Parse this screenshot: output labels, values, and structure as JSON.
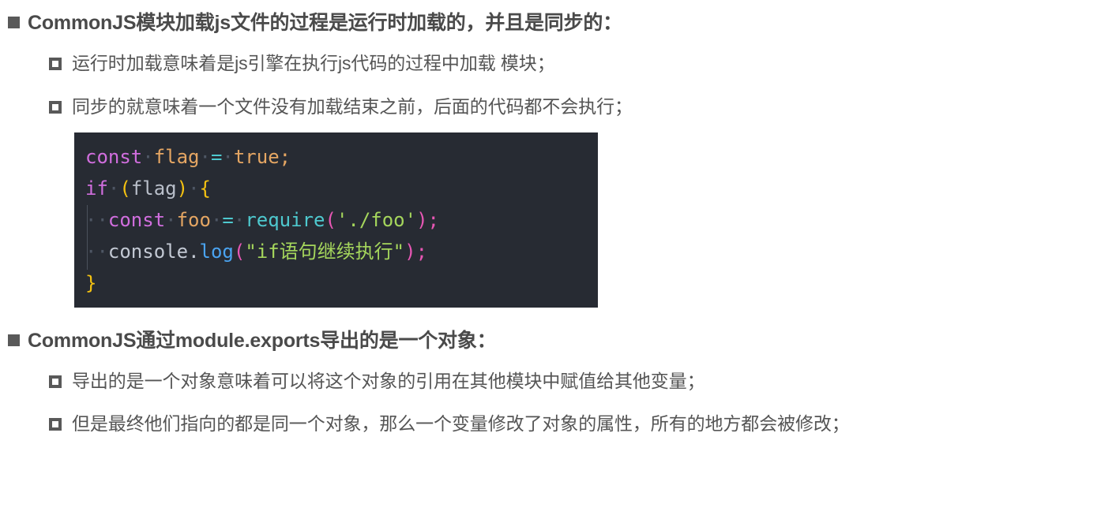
{
  "slide": {
    "bullets": [
      {
        "level": 1,
        "marker": "filled-square",
        "text": "CommonJS模块加载js文件的过程是运行时加载的，并且是同步的："
      },
      {
        "level": 2,
        "marker": "hollow-square",
        "text": "运行时加载意味着是js引擎在执行js代码的过程中加载 模块；"
      },
      {
        "level": 2,
        "marker": "hollow-square",
        "text": "同步的就意味着一个文件没有加载结束之前，后面的代码都不会执行；"
      },
      {
        "level": 1,
        "marker": "filled-square",
        "text": "CommonJS通过module.exports导出的是一个对象："
      },
      {
        "level": 2,
        "marker": "hollow-square",
        "text": "导出的是一个对象意味着可以将这个对象的引用在其他模块中赋值给其他变量；"
      },
      {
        "level": 2,
        "marker": "hollow-square",
        "text": "但是最终他们指向的都是同一个对象，那么一个变量修改了对象的属性，所有的地方都会被修改；"
      }
    ]
  },
  "code_block": {
    "background": "#272b33",
    "language": "javascript",
    "plain_text": "const flag = true;\nif (flag) {\n  const foo = require('./foo');\n  console.log(\"if语句继续执行\");\n}",
    "lines": [
      {
        "n": 1,
        "indent": false,
        "tokens": [
          {
            "text": "const",
            "color": "#d16ede"
          },
          {
            "text": "·",
            "color": "#4e5664"
          },
          {
            "text": "flag",
            "color": "#e5a663"
          },
          {
            "text": "·",
            "color": "#4e5664"
          },
          {
            "text": "=",
            "color": "#4ec9cf"
          },
          {
            "text": "·",
            "color": "#4e5664"
          },
          {
            "text": "true",
            "color": "#e5a663"
          },
          {
            "text": ";",
            "color": "#e5a663"
          }
        ]
      },
      {
        "n": 2,
        "indent": false,
        "tokens": [
          {
            "text": "if",
            "color": "#d16ede"
          },
          {
            "text": "·",
            "color": "#4e5664"
          },
          {
            "text": "(",
            "color": "#f5c211"
          },
          {
            "text": "flag",
            "color": "#b9bfca"
          },
          {
            "text": ")",
            "color": "#f5c211"
          },
          {
            "text": "·",
            "color": "#4e5664"
          },
          {
            "text": "{",
            "color": "#f5c211"
          }
        ]
      },
      {
        "n": 3,
        "indent": true,
        "tokens": [
          {
            "text": "··",
            "color": "#4e5664"
          },
          {
            "text": "const",
            "color": "#d16ede"
          },
          {
            "text": "·",
            "color": "#4e5664"
          },
          {
            "text": "foo",
            "color": "#e5a663"
          },
          {
            "text": "·",
            "color": "#4e5664"
          },
          {
            "text": "=",
            "color": "#4ec9cf"
          },
          {
            "text": "·",
            "color": "#4e5664"
          },
          {
            "text": "require",
            "color": "#4ec9cf"
          },
          {
            "text": "(",
            "color": "#e857b5"
          },
          {
            "text": "'./foo'",
            "color": "#a5d65c"
          },
          {
            "text": ")",
            "color": "#e857b5"
          },
          {
            "text": ";",
            "color": "#e857b5"
          }
        ]
      },
      {
        "n": 4,
        "indent": true,
        "tokens": [
          {
            "text": "··",
            "color": "#4e5664"
          },
          {
            "text": "console",
            "color": "#c3c9d4"
          },
          {
            "text": ".",
            "color": "#c3c9d4"
          },
          {
            "text": "log",
            "color": "#4aa3f0"
          },
          {
            "text": "(",
            "color": "#e857b5"
          },
          {
            "text": "\"if语句继续执行\"",
            "color": "#a5d65c"
          },
          {
            "text": ")",
            "color": "#e857b5"
          },
          {
            "text": ";",
            "color": "#e857b5"
          }
        ]
      },
      {
        "n": 5,
        "indent": false,
        "tokens": [
          {
            "text": "}",
            "color": "#f5c211"
          }
        ]
      }
    ]
  },
  "theme": {
    "page_background": "#ffffff",
    "text_color": "#4f4f4f",
    "marker_color": "#595959"
  }
}
